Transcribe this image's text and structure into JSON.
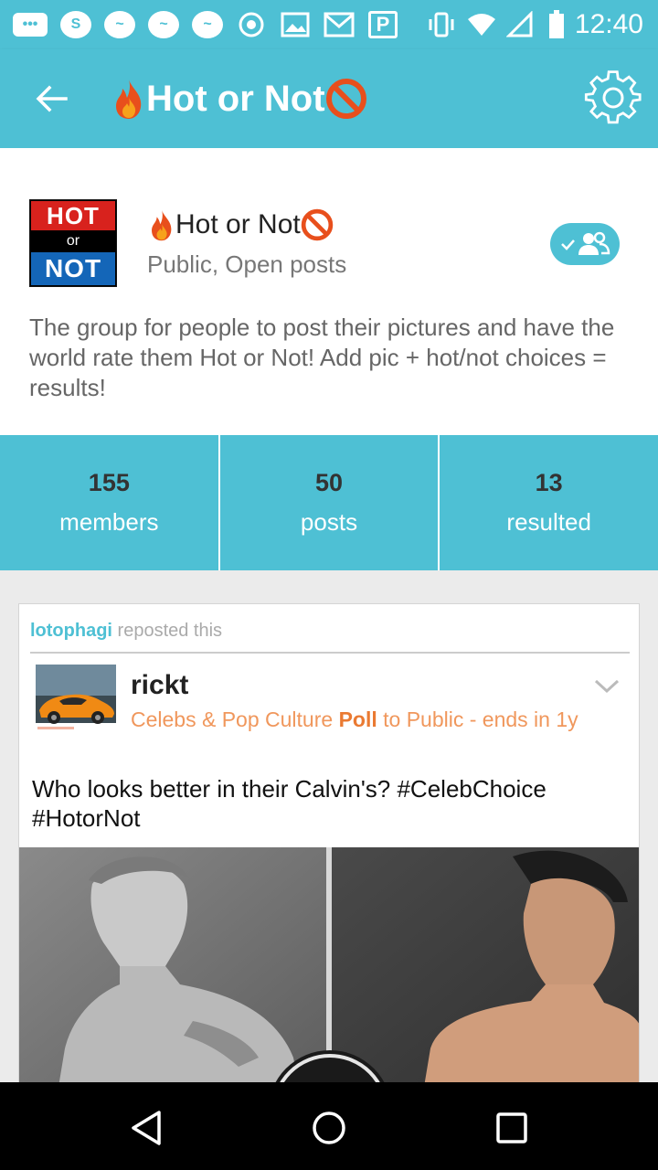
{
  "status_bar": {
    "time": "12:40",
    "notification_icons": [
      "more-icon",
      "skype-icon",
      "messenger-icon",
      "messenger-icon",
      "messenger-icon",
      "settings-app-icon",
      "gallery-icon",
      "gmail-icon",
      "pandora-icon"
    ],
    "system_icons": [
      "vibrate-icon",
      "wifi-icon",
      "signal-icon",
      "battery-icon"
    ]
  },
  "app_bar": {
    "title": "Hot or Not",
    "accent": "#4ec0d4"
  },
  "group": {
    "logo": {
      "hot": "HOT",
      "or": "or",
      "not": "NOT"
    },
    "name": "Hot or Not",
    "meta": "Public, Open posts",
    "description": "The group for people to post their pictures and have the world rate them Hot or Not! Add pic + hot/not choices = results!"
  },
  "stats": [
    {
      "count": "155",
      "label": "members"
    },
    {
      "count": "50",
      "label": "posts"
    },
    {
      "count": "13",
      "label": "resulted"
    }
  ],
  "post": {
    "reposter": "lotophagi",
    "repost_text": "reposted this",
    "author": "rickt",
    "category": "Celebs & Pop Culture",
    "type": "Poll",
    "audience": "to Public -  ends in 1y",
    "text": "Who looks better in their Calvin's? #CelebChoice #HotorNot"
  },
  "colors": {
    "brand": "#4ec0d4",
    "meta_orange": "#f0975c",
    "logo_red": "#d8221d",
    "logo_blue": "#1466b8"
  }
}
